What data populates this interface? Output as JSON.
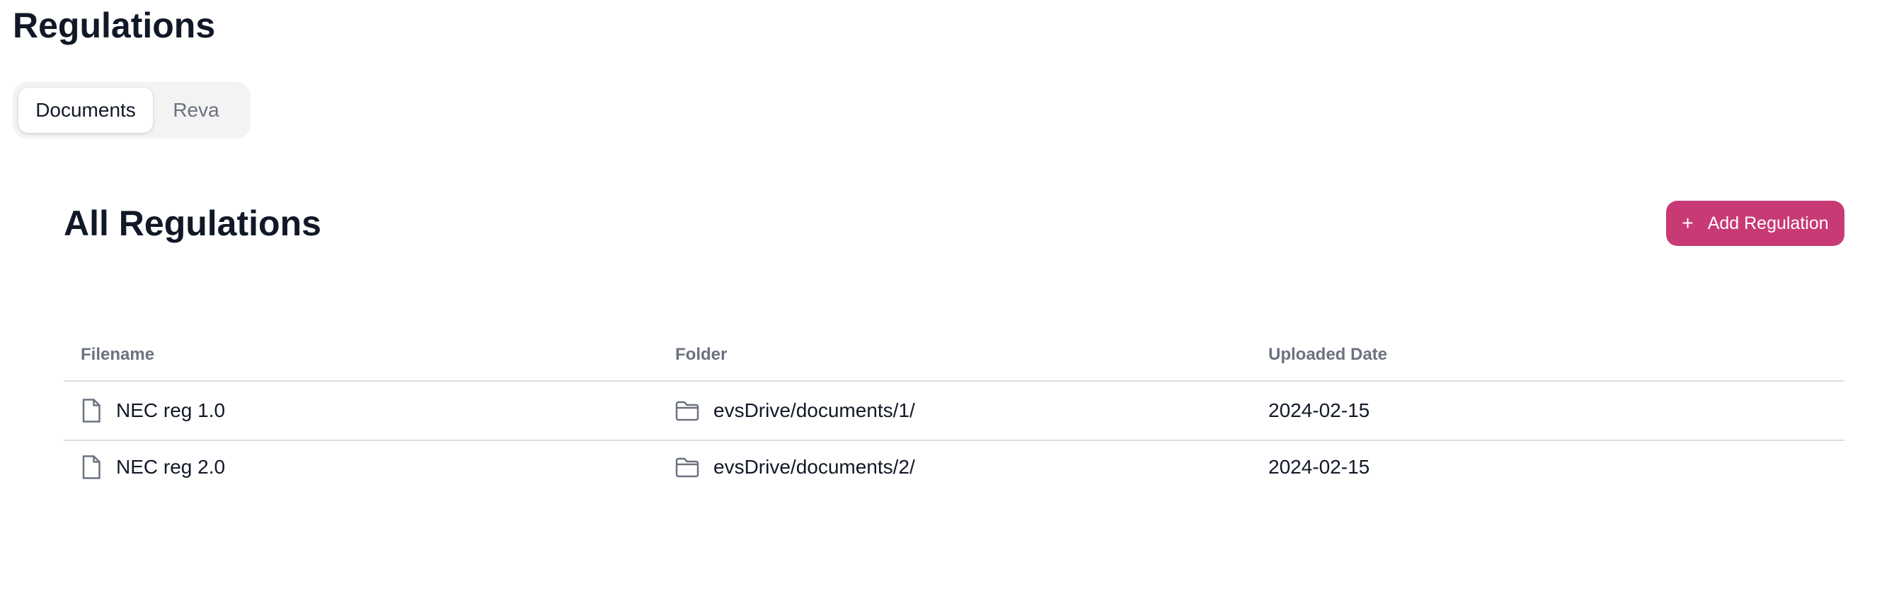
{
  "page": {
    "title": "Regulations"
  },
  "tabs": [
    {
      "label": "Documents",
      "active": true
    },
    {
      "label": "Reva",
      "active": false
    }
  ],
  "section": {
    "title": "All Regulations",
    "add_button_label": "Add Regulation",
    "add_button_icon": "plus-icon"
  },
  "table": {
    "columns": [
      "Filename",
      "Folder",
      "Uploaded Date"
    ],
    "rows": [
      {
        "filename": "NEC reg 1.0",
        "folder": "evsDrive/documents/1/",
        "uploaded_date": "2024-02-15"
      },
      {
        "filename": "NEC reg 2.0",
        "folder": "evsDrive/documents/2/",
        "uploaded_date": "2024-02-15"
      }
    ]
  },
  "colors": {
    "accent": "#c83a75",
    "text": "#111827",
    "muted": "#6b7280",
    "border": "#dedee3",
    "tab_bg": "#f3f3f4"
  }
}
